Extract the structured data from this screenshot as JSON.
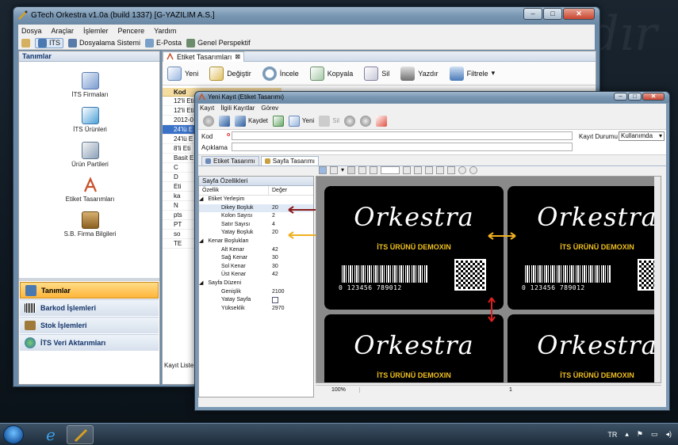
{
  "main_window": {
    "title": "GTech Orkestra v1.0a (build 1337) [G-YAZILIM A.S.]",
    "menu": [
      "Dosya",
      "Araçlar",
      "İşlemler",
      "Pencere",
      "Yardım"
    ],
    "toolbar": [
      {
        "label": "ITS",
        "icon": "its-icon",
        "active": true
      },
      {
        "label": "Dosyalama Sistemi",
        "icon": "folder-icon"
      },
      {
        "label": "E-Posta",
        "icon": "email-icon"
      },
      {
        "label": "Genel Perspektif",
        "icon": "perspective-icon"
      }
    ],
    "left_panel": {
      "header": "Tanımlar",
      "items": [
        {
          "label": "İTS Firmaları",
          "icon": "company-icon"
        },
        {
          "label": "İTS Ürünleri",
          "icon": "product-icon"
        },
        {
          "label": "Ürün Partileri",
          "icon": "batch-icon"
        },
        {
          "label": "Etiket Tasarımları",
          "icon": "label-design-icon"
        },
        {
          "label": "S.B. Firma Bilgileri",
          "icon": "briefcase-icon"
        }
      ],
      "nav": [
        {
          "label": "Tanımlar",
          "icon": "definitions-icon",
          "active": true
        },
        {
          "label": "Barkod İşlemleri",
          "icon": "barcode-icon"
        },
        {
          "label": "Stok İşlemleri",
          "icon": "stock-icon"
        },
        {
          "label": "İTS Veri Aktarımları",
          "icon": "globe-icon"
        }
      ]
    },
    "content_tab": "Etiket Tasarımları",
    "content_toolbar": [
      "Yeni",
      "Değiştir",
      "İncele",
      "Kopyala",
      "Sil",
      "Yazdır",
      "Filtrele"
    ],
    "grid": {
      "header": "Kod",
      "rows": [
        "12'li Eti",
        "12'li Eti",
        "2012-0",
        "24'lü E",
        "24'lü E",
        "8'li Eti",
        "Basit E",
        "C",
        "D",
        "Eti",
        "ka",
        "N",
        "pts",
        "PT",
        "so",
        "TE"
      ],
      "selected_index": 3
    },
    "footer": "Kayıt Liste"
  },
  "sub_window": {
    "title": "Yeni Kayıt (Etiket Tasarımı)",
    "menu": [
      "Kayıt",
      "İlgili Kayıtlar",
      "Görev"
    ],
    "toolbar": [
      {
        "label": "",
        "icon": "back-icon"
      },
      {
        "label": "",
        "icon": "save-icon"
      },
      {
        "label": "Kaydet",
        "icon": "save-icon"
      },
      {
        "label": "",
        "icon": "new-doc-icon"
      },
      {
        "label": "Yeni",
        "icon": "new-icon"
      },
      {
        "label": "Sil",
        "icon": "delete-icon"
      }
    ],
    "fields": {
      "kod_label": "Kod",
      "aciklama_label": "Açıklama",
      "kayit_durumu_label": "Kayıt Durumu",
      "kayit_durumu_value": "Kullanımda",
      "required_mark": "o"
    },
    "tabs": [
      "Etiket Tasarımı",
      "Sayfa Tasarımı"
    ],
    "active_tab": 1,
    "properties": {
      "header": "Sayfa Özellikleri",
      "col_name": "Özellik",
      "col_value": "Değer",
      "rows": [
        {
          "type": "cat",
          "name": "Etiket Yerleşim",
          "value": ""
        },
        {
          "type": "sub",
          "name": "Dikey Boşluk",
          "value": "20",
          "highlight": true
        },
        {
          "type": "sub",
          "name": "Kolon Sayısı",
          "value": "2"
        },
        {
          "type": "sub",
          "name": "Satır Sayısı",
          "value": "4"
        },
        {
          "type": "sub",
          "name": "Yatay Boşluk",
          "value": "20"
        },
        {
          "type": "cat",
          "name": "Kenar Boşlukları",
          "value": ""
        },
        {
          "type": "sub",
          "name": "Alt Kenar",
          "value": "42"
        },
        {
          "type": "sub",
          "name": "Sağ Kenar",
          "value": "30"
        },
        {
          "type": "sub",
          "name": "Sol Kenar",
          "value": "30"
        },
        {
          "type": "sub",
          "name": "Üst Kenar",
          "value": "42"
        },
        {
          "type": "cat",
          "name": "Sayfa Düzeni",
          "value": ""
        },
        {
          "type": "sub",
          "name": "Genişlik",
          "value": "2100"
        },
        {
          "type": "sub",
          "name": "Yatay Sayfa",
          "value": "",
          "checkbox": true
        },
        {
          "type": "sub",
          "name": "Yükseklik",
          "value": "2970"
        }
      ]
    },
    "preview": {
      "brand": "Orkestra",
      "product": "İTS ÜRÜNÜ DEMOXIN",
      "barcode_number": "0 123456 789012",
      "zoom": "100%",
      "page": "1"
    }
  },
  "taskbar": {
    "lang": "TR"
  }
}
